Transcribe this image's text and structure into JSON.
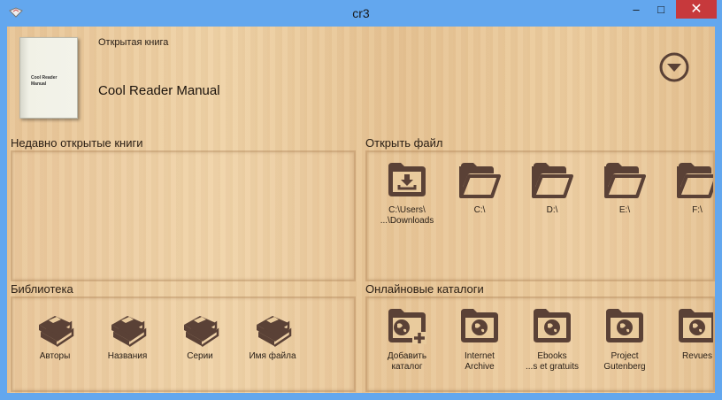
{
  "window": {
    "title": "cr3",
    "minimize": "–",
    "maximize": "□",
    "close": "✕"
  },
  "current": {
    "heading": "Открытая книга",
    "book_title": "Cool Reader Manual",
    "cover_text": [
      "Cool Reader",
      "Manual"
    ]
  },
  "sections": {
    "recent": "Недавно открытые книги",
    "open_file": "Открыть файл",
    "library": "Библиотека",
    "online": "Онлайновые каталоги"
  },
  "files": [
    {
      "icon": "download-folder-icon",
      "line1": "C:\\Users\\",
      "line2": "...\\Downloads"
    },
    {
      "icon": "folder-open-icon",
      "line1": "C:\\",
      "line2": ""
    },
    {
      "icon": "folder-open-icon",
      "line1": "D:\\",
      "line2": ""
    },
    {
      "icon": "folder-open-icon",
      "line1": "E:\\",
      "line2": ""
    },
    {
      "icon": "folder-open-icon",
      "line1": "F:\\",
      "line2": ""
    }
  ],
  "library": [
    {
      "icon": "books-icon",
      "label": "Авторы"
    },
    {
      "icon": "books-icon",
      "label": "Названия"
    },
    {
      "icon": "books-icon",
      "label": "Серии"
    },
    {
      "icon": "books-icon",
      "label": "Имя файла"
    }
  ],
  "catalogs": [
    {
      "icon": "globe-folder-add-icon",
      "line1": "Добавить",
      "line2": "каталог"
    },
    {
      "icon": "globe-folder-icon",
      "line1": "Internet",
      "line2": "Archive"
    },
    {
      "icon": "globe-folder-icon",
      "line1": "Ebooks",
      "line2": "...s et gratuits"
    },
    {
      "icon": "globe-folder-icon",
      "line1": "Project",
      "line2": "Gutenberg"
    },
    {
      "icon": "globe-folder-icon",
      "line1": "Revues",
      "line2": ""
    }
  ],
  "colors": {
    "icon": "#5a4136",
    "titlebar": "#63a7ee",
    "close": "#c7393c"
  }
}
